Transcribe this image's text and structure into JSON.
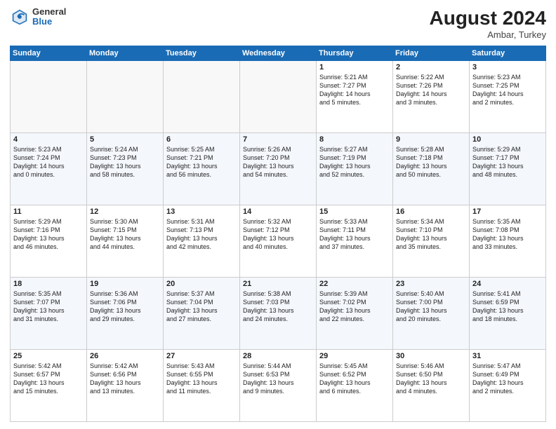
{
  "header": {
    "logo_general": "General",
    "logo_blue": "Blue",
    "month_year": "August 2024",
    "location": "Ambar, Turkey"
  },
  "weekdays": [
    "Sunday",
    "Monday",
    "Tuesday",
    "Wednesday",
    "Thursday",
    "Friday",
    "Saturday"
  ],
  "weeks": [
    [
      {
        "day": "",
        "info": ""
      },
      {
        "day": "",
        "info": ""
      },
      {
        "day": "",
        "info": ""
      },
      {
        "day": "",
        "info": ""
      },
      {
        "day": "1",
        "info": "Sunrise: 5:21 AM\nSunset: 7:27 PM\nDaylight: 14 hours\nand 5 minutes."
      },
      {
        "day": "2",
        "info": "Sunrise: 5:22 AM\nSunset: 7:26 PM\nDaylight: 14 hours\nand 3 minutes."
      },
      {
        "day": "3",
        "info": "Sunrise: 5:23 AM\nSunset: 7:25 PM\nDaylight: 14 hours\nand 2 minutes."
      }
    ],
    [
      {
        "day": "4",
        "info": "Sunrise: 5:23 AM\nSunset: 7:24 PM\nDaylight: 14 hours\nand 0 minutes."
      },
      {
        "day": "5",
        "info": "Sunrise: 5:24 AM\nSunset: 7:23 PM\nDaylight: 13 hours\nand 58 minutes."
      },
      {
        "day": "6",
        "info": "Sunrise: 5:25 AM\nSunset: 7:21 PM\nDaylight: 13 hours\nand 56 minutes."
      },
      {
        "day": "7",
        "info": "Sunrise: 5:26 AM\nSunset: 7:20 PM\nDaylight: 13 hours\nand 54 minutes."
      },
      {
        "day": "8",
        "info": "Sunrise: 5:27 AM\nSunset: 7:19 PM\nDaylight: 13 hours\nand 52 minutes."
      },
      {
        "day": "9",
        "info": "Sunrise: 5:28 AM\nSunset: 7:18 PM\nDaylight: 13 hours\nand 50 minutes."
      },
      {
        "day": "10",
        "info": "Sunrise: 5:29 AM\nSunset: 7:17 PM\nDaylight: 13 hours\nand 48 minutes."
      }
    ],
    [
      {
        "day": "11",
        "info": "Sunrise: 5:29 AM\nSunset: 7:16 PM\nDaylight: 13 hours\nand 46 minutes."
      },
      {
        "day": "12",
        "info": "Sunrise: 5:30 AM\nSunset: 7:15 PM\nDaylight: 13 hours\nand 44 minutes."
      },
      {
        "day": "13",
        "info": "Sunrise: 5:31 AM\nSunset: 7:13 PM\nDaylight: 13 hours\nand 42 minutes."
      },
      {
        "day": "14",
        "info": "Sunrise: 5:32 AM\nSunset: 7:12 PM\nDaylight: 13 hours\nand 40 minutes."
      },
      {
        "day": "15",
        "info": "Sunrise: 5:33 AM\nSunset: 7:11 PM\nDaylight: 13 hours\nand 37 minutes."
      },
      {
        "day": "16",
        "info": "Sunrise: 5:34 AM\nSunset: 7:10 PM\nDaylight: 13 hours\nand 35 minutes."
      },
      {
        "day": "17",
        "info": "Sunrise: 5:35 AM\nSunset: 7:08 PM\nDaylight: 13 hours\nand 33 minutes."
      }
    ],
    [
      {
        "day": "18",
        "info": "Sunrise: 5:35 AM\nSunset: 7:07 PM\nDaylight: 13 hours\nand 31 minutes."
      },
      {
        "day": "19",
        "info": "Sunrise: 5:36 AM\nSunset: 7:06 PM\nDaylight: 13 hours\nand 29 minutes."
      },
      {
        "day": "20",
        "info": "Sunrise: 5:37 AM\nSunset: 7:04 PM\nDaylight: 13 hours\nand 27 minutes."
      },
      {
        "day": "21",
        "info": "Sunrise: 5:38 AM\nSunset: 7:03 PM\nDaylight: 13 hours\nand 24 minutes."
      },
      {
        "day": "22",
        "info": "Sunrise: 5:39 AM\nSunset: 7:02 PM\nDaylight: 13 hours\nand 22 minutes."
      },
      {
        "day": "23",
        "info": "Sunrise: 5:40 AM\nSunset: 7:00 PM\nDaylight: 13 hours\nand 20 minutes."
      },
      {
        "day": "24",
        "info": "Sunrise: 5:41 AM\nSunset: 6:59 PM\nDaylight: 13 hours\nand 18 minutes."
      }
    ],
    [
      {
        "day": "25",
        "info": "Sunrise: 5:42 AM\nSunset: 6:57 PM\nDaylight: 13 hours\nand 15 minutes."
      },
      {
        "day": "26",
        "info": "Sunrise: 5:42 AM\nSunset: 6:56 PM\nDaylight: 13 hours\nand 13 minutes."
      },
      {
        "day": "27",
        "info": "Sunrise: 5:43 AM\nSunset: 6:55 PM\nDaylight: 13 hours\nand 11 minutes."
      },
      {
        "day": "28",
        "info": "Sunrise: 5:44 AM\nSunset: 6:53 PM\nDaylight: 13 hours\nand 9 minutes."
      },
      {
        "day": "29",
        "info": "Sunrise: 5:45 AM\nSunset: 6:52 PM\nDaylight: 13 hours\nand 6 minutes."
      },
      {
        "day": "30",
        "info": "Sunrise: 5:46 AM\nSunset: 6:50 PM\nDaylight: 13 hours\nand 4 minutes."
      },
      {
        "day": "31",
        "info": "Sunrise: 5:47 AM\nSunset: 6:49 PM\nDaylight: 13 hours\nand 2 minutes."
      }
    ]
  ]
}
